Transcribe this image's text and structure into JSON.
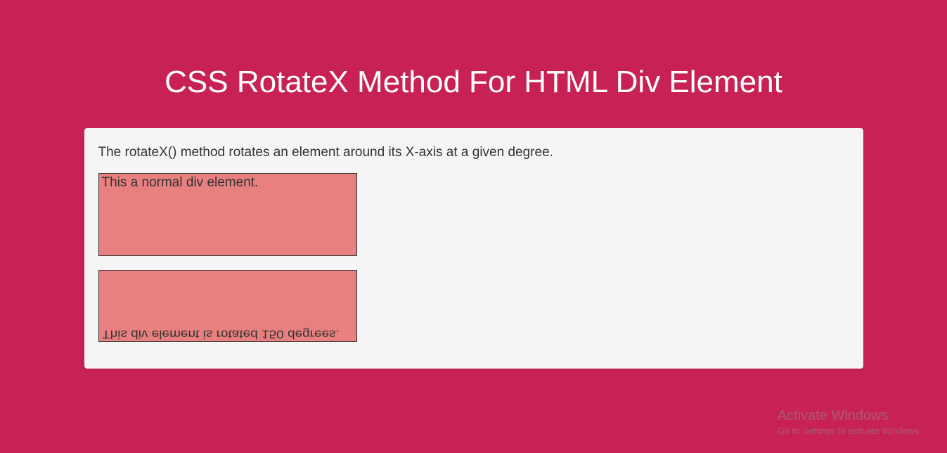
{
  "header": {
    "title": "CSS RotateX Method For HTML Div Element"
  },
  "main": {
    "description": "The rotateX() method rotates an element around its X-axis at a given degree.",
    "normal_box_text": "This a normal div element.",
    "rotated_box_text": "This div element is rotated 150 degrees."
  },
  "watermark": {
    "title": "Activate Windows",
    "subtitle": "Go to Settings to activate Windows."
  }
}
